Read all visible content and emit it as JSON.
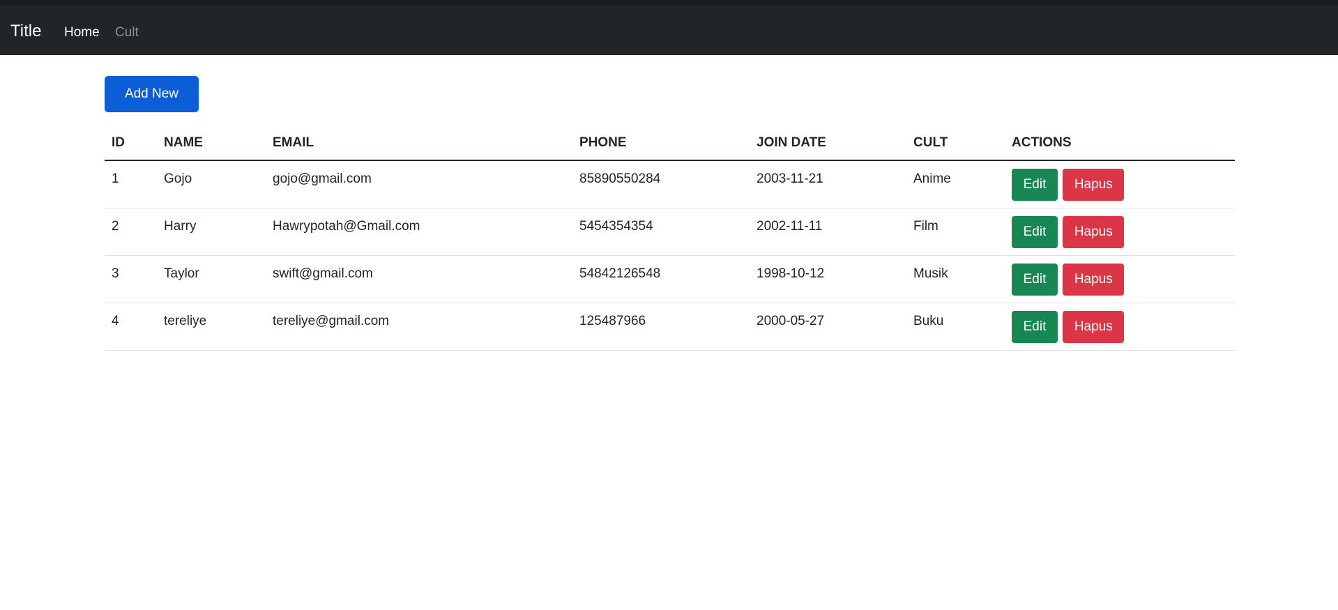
{
  "navbar": {
    "brand": "Title",
    "links": [
      {
        "label": "Home",
        "active": true
      },
      {
        "label": "Cult",
        "active": false
      }
    ]
  },
  "toolbar": {
    "add_label": "Add New"
  },
  "table": {
    "headers": [
      "ID",
      "NAME",
      "EMAIL",
      "PHONE",
      "JOIN DATE",
      "CULT",
      "ACTIONS"
    ],
    "rows": [
      {
        "id": "1",
        "name": "Gojo",
        "email": "gojo@gmail.com",
        "phone": "85890550284",
        "join_date": "2003-11-21",
        "cult": "Anime"
      },
      {
        "id": "2",
        "name": "Harry",
        "email": "Hawrypotah@Gmail.com",
        "phone": "5454354354",
        "join_date": "2002-11-11",
        "cult": "Film"
      },
      {
        "id": "3",
        "name": "Taylor",
        "email": "swift@gmail.com",
        "phone": "54842126548",
        "join_date": "1998-10-12",
        "cult": "Musik"
      },
      {
        "id": "4",
        "name": "tereliye",
        "email": "tereliye@gmail.com",
        "phone": "125487966",
        "join_date": "2000-05-27",
        "cult": "Buku"
      }
    ],
    "edit_label": "Edit",
    "delete_label": "Hapus"
  },
  "colors": {
    "navbar_bg": "#212529",
    "primary": "#0b5ed7",
    "success": "#198754",
    "danger": "#dc3545"
  }
}
